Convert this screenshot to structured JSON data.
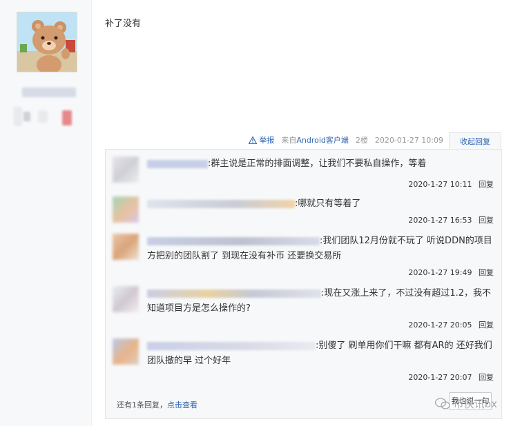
{
  "post": {
    "text": "补了没有"
  },
  "meta": {
    "report_label": "举报",
    "client_label": "来自Android客户端",
    "floor": "2楼",
    "datetime": "2020-01-27 10:09",
    "collapse_label": "收起回复"
  },
  "replies": [
    {
      "text": ":群主说是正常的排面调整，让我们不要私自操作，等着",
      "time": "2020-1-27 10:11",
      "action": "回复"
    },
    {
      "text": ":哪就只有等着了",
      "time": "2020-1-27 16:53",
      "action": "回复"
    },
    {
      "text": ":我们团队12月份就不玩了 听说DDN的项目方把别的团队割了 到现在没有补币 还要换交易所",
      "time": "2020-1-27 19:49",
      "action": "回复"
    },
    {
      "text": ":现在又涨上来了，不过没有超过1.2，我不知道项目方是怎么操作的?",
      "time": "2020-1-27 20:05",
      "action": "回复"
    },
    {
      "text": ":别傻了 刷单用你们干嘛 都有AR的 还好我们团队撤的早 过个好年",
      "time": "2020-1-27 20:07",
      "action": "回复"
    }
  ],
  "footer": {
    "more_text": "还有1条回复，",
    "more_link": "点击查看",
    "reply_button": "我也说一句"
  },
  "watermark": {
    "text": "币快讯bx"
  }
}
